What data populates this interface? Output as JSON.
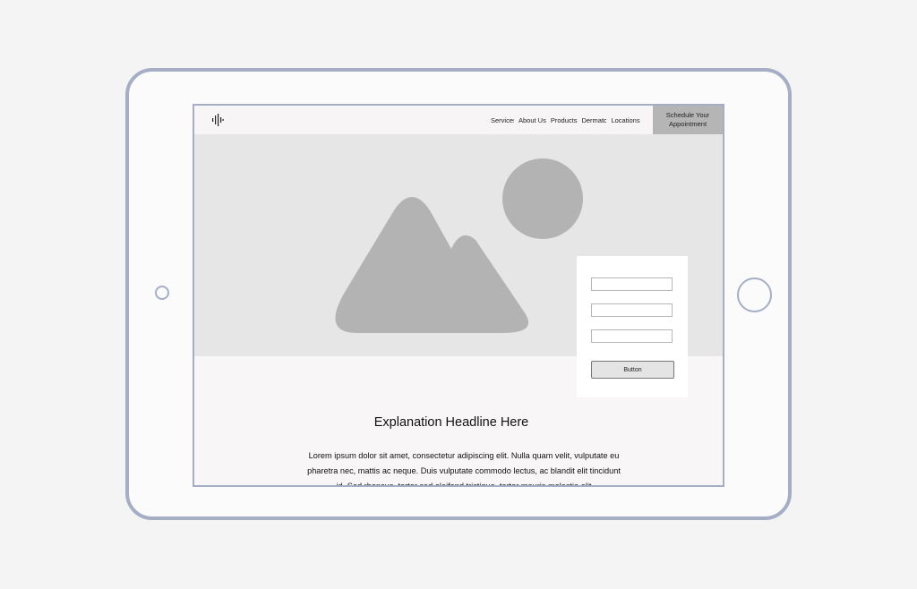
{
  "nav": {
    "logo_icon": "audio-wave-icon",
    "links": [
      "Services",
      "About Us",
      "Products",
      "Dermatology",
      "Locations"
    ],
    "cta_label": "Schedule Your Appointment"
  },
  "hero": {
    "image_icon": "image-placeholder-icon",
    "form": {
      "fields": [
        "",
        "",
        ""
      ],
      "button_label": "Button"
    }
  },
  "content": {
    "headline": "Explanation Headline Here",
    "body": "Lorem ipsum dolor sit amet, consectetur adipiscing elit. Nulla quam velit, vulputate eu pharetra nec, mattis ac neque. Duis vulputate commodo lectus, ac blandit elit tincidunt id. Sed rhoncus, tortor sed eleifend tristique, tortor mauris molestie elit"
  },
  "colors": {
    "device_frame": "#a5aec4",
    "hero_bg": "#e6e6e6",
    "placeholder": "#b3b3b3",
    "cta_bg": "#b5b5b5"
  }
}
